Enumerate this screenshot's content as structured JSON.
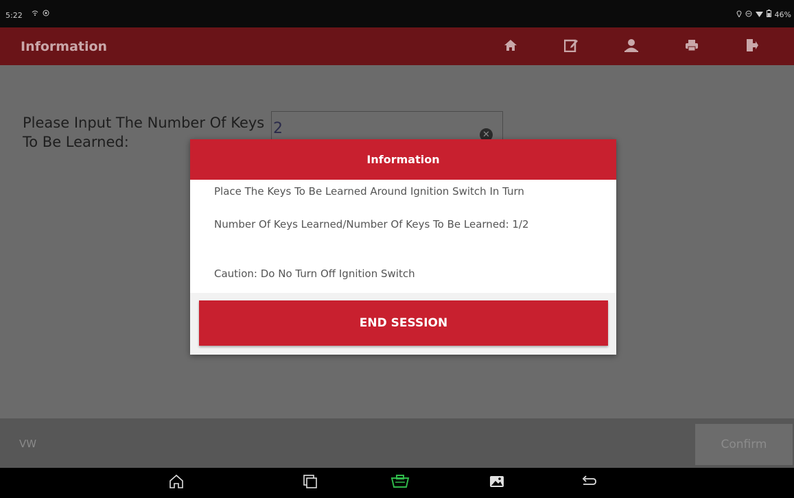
{
  "status_bar": {
    "time": "5:22",
    "battery": "46%"
  },
  "app_bar": {
    "title": "Information",
    "icons": [
      "home-icon",
      "edit-report-icon",
      "user-icon",
      "print-icon",
      "exit-icon"
    ]
  },
  "form": {
    "label": "Please Input The Number Of Keys To Be Learned:",
    "value": "2"
  },
  "dialog": {
    "title": "Information",
    "line1": "Place The Keys To Be Learned Around Ignition Switch In Turn",
    "line2": "Number Of Keys Learned/Number Of Keys To Be Learned: 1/2",
    "line3": "Caution: Do No Turn Off Ignition Switch",
    "button": "END SESSION"
  },
  "bottom_bar": {
    "brand": "VW",
    "confirm": "Confirm"
  },
  "nav_bar": {
    "icons": [
      "android-home-icon",
      "recent-apps-icon",
      "vci-connector-icon",
      "screenshot-icon",
      "back-icon"
    ]
  },
  "colors": {
    "accent": "#c8202f",
    "app_bar": "#6a1418",
    "overlay_bg": "#6b6b6b"
  }
}
